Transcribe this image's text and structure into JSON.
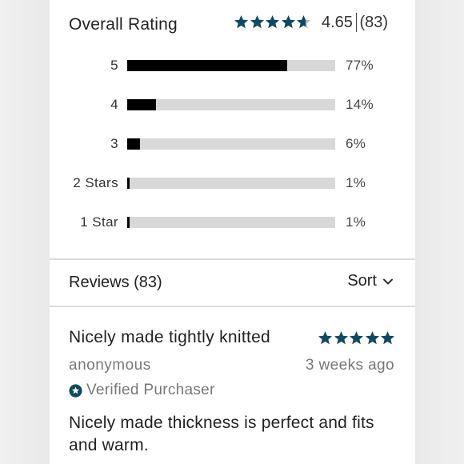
{
  "overall": {
    "title": "Overall Rating",
    "score": "4.65",
    "count": "(83)",
    "rating_value": 4.65,
    "stars_max": 5
  },
  "distribution": [
    {
      "label": "5",
      "percent": 77,
      "percent_text": "77%"
    },
    {
      "label": "4",
      "percent": 14,
      "percent_text": "14%"
    },
    {
      "label": "3",
      "percent": 6,
      "percent_text": "6%"
    },
    {
      "label": "2 Stars",
      "percent": 1,
      "percent_text": "1%"
    },
    {
      "label": "1 Star",
      "percent": 1,
      "percent_text": "1%"
    }
  ],
  "reviews_header": {
    "title": "Reviews (83)",
    "sort_label": "Sort"
  },
  "review": {
    "title": "Nicely made tightly knitted",
    "rating": 5,
    "author": "anonymous",
    "date": "3 weeks ago",
    "verified_label": "Verified Purchaser",
    "body": "Nicely made thickness is perfect and fits and warm."
  },
  "colors": {
    "star": "#0e4a64",
    "star_empty": "#b8b8b8",
    "bar_fill": "#000000",
    "bar_track": "#d8d8d8"
  },
  "icons": {
    "star": "star-icon",
    "sort": "chevron-down-icon",
    "verified": "verified-star-badge-icon"
  }
}
